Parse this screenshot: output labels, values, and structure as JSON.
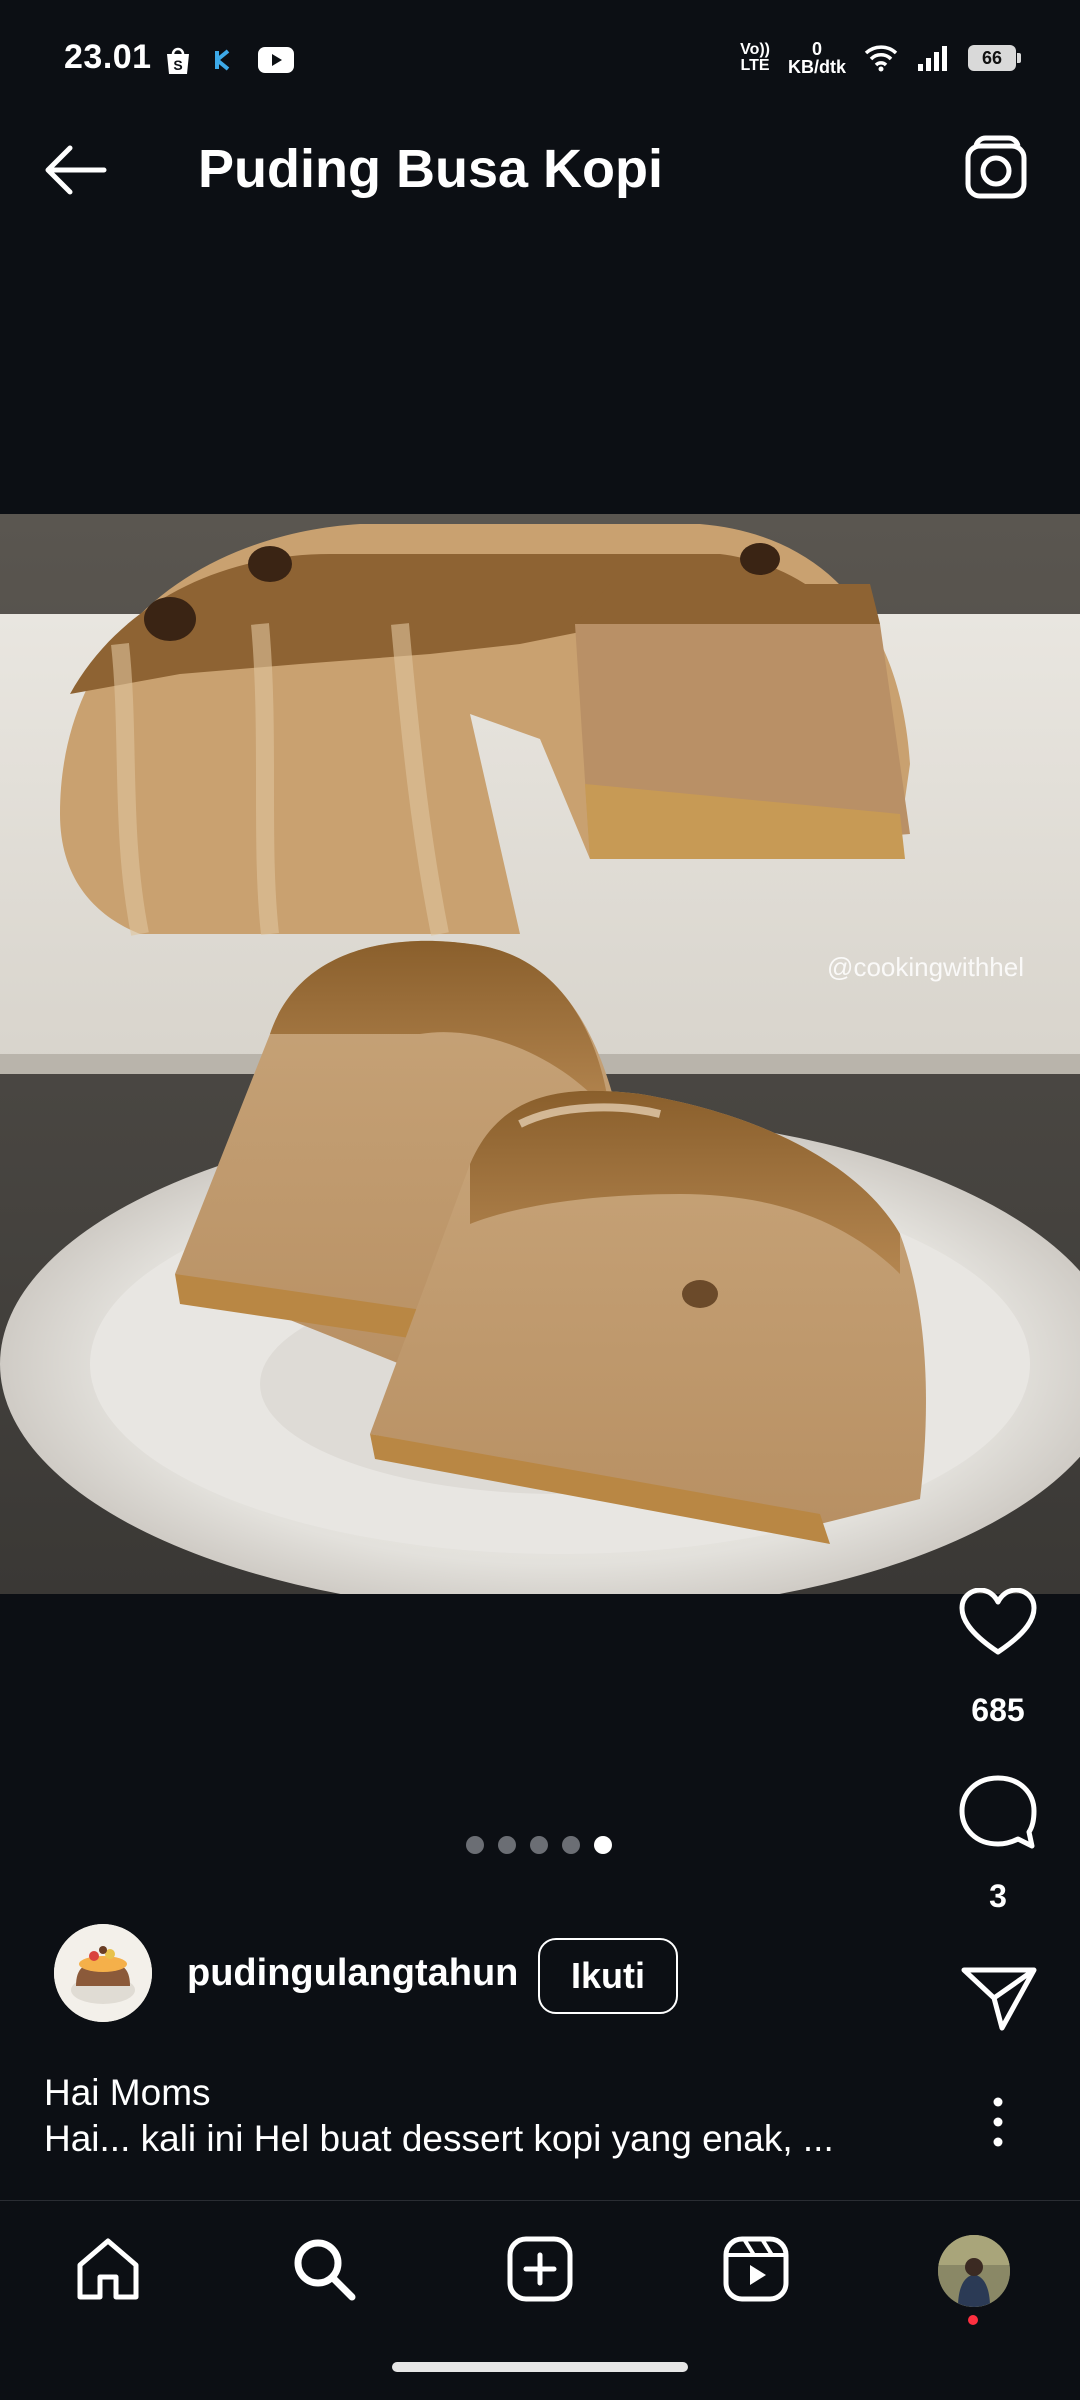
{
  "status_bar": {
    "time": "23.01",
    "volte": "Vo)) LTE",
    "net_speed_value": "0",
    "net_speed_unit": "KB/dtk",
    "battery": "66",
    "left_icons": [
      "shopee-icon",
      "k-app-icon",
      "youtube-icon"
    ],
    "right_icons": [
      "volte-icon",
      "wifi-icon",
      "signal-icon",
      "battery-icon"
    ]
  },
  "header": {
    "title": "Puding Busa Kopi",
    "back_icon": "back-arrow-icon",
    "camera_icon": "camera-icon"
  },
  "post": {
    "watermark": "@cookingwithhel",
    "likes": "685",
    "comments": "3",
    "carousel": {
      "total": 5,
      "active_index": 4
    },
    "author": {
      "username": "pudingulangtahun",
      "follow_label": "Ikuti"
    },
    "caption": {
      "line1": "Hai Moms",
      "line2": "Hai... kali ini Hel buat dessert kopi yang enak, ..."
    }
  },
  "bottom_nav": {
    "items": [
      "home-icon",
      "search-icon",
      "create-icon",
      "reels-icon",
      "profile-avatar"
    ]
  },
  "colors": {
    "background": "#0c0f14",
    "notification_dot": "#ff3040"
  }
}
